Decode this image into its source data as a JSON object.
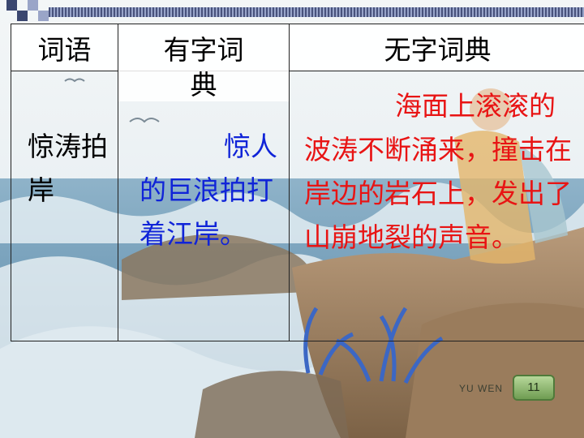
{
  "table": {
    "headers": [
      "词语",
      "有字词",
      "无字词典"
    ],
    "header_dict_continuation": "典",
    "row": {
      "word": "惊涛拍岸",
      "dictionary_meaning": "惊人的巨浪拍打着江岸。",
      "no_dictionary_meaning": "海面上滚滚的波涛不断涌来，撞击在岸边的岩石上，发出了山崩地裂的声音。"
    }
  },
  "footer": {
    "label": "YU WEN",
    "page_number": "11"
  },
  "colors": {
    "dictionary_text": "#1024d8",
    "no_dictionary_text": "#e81414",
    "border": "#222222"
  }
}
